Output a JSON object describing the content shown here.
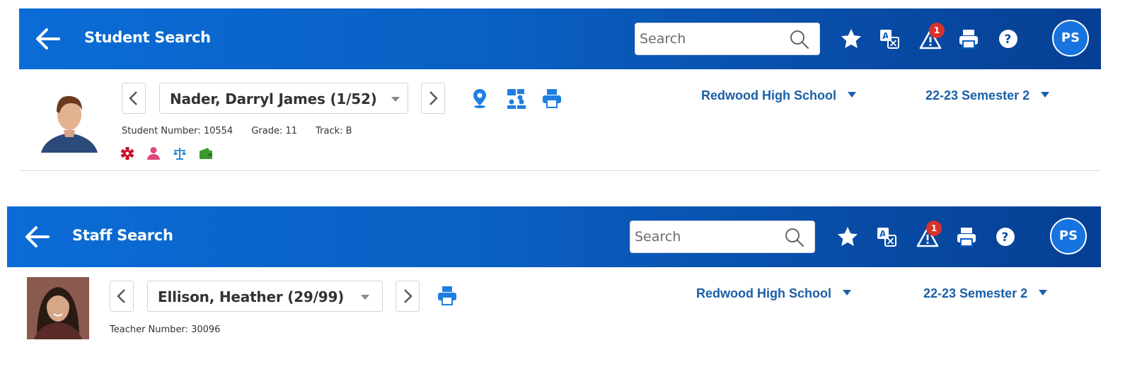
{
  "student_panel": {
    "header": {
      "title": "Student Search",
      "search_placeholder": "Search",
      "alert_count": "1",
      "user_initials": "PS"
    },
    "record": {
      "name_selector": "Nader, Darryl James  (1/52)",
      "details": [
        "Student Number: 10554",
        "Grade: 11",
        "Track: B"
      ],
      "indicator_icons": [
        "medical-alert-icon",
        "person-alert-icon",
        "legal-alert-icon",
        "fee-wallet-icon"
      ]
    },
    "school_selector": "Redwood High School",
    "term_selector": "22-23 Semester 2"
  },
  "staff_panel": {
    "header": {
      "title": "Staff Search",
      "search_placeholder": "Search",
      "alert_count": "1",
      "user_initials": "PS"
    },
    "record": {
      "name_selector": "Ellison, Heather  (29/99)",
      "details": [
        "Teacher Number: 30096"
      ]
    },
    "school_selector": "Redwood High School",
    "term_selector": "22-23 Semester 2"
  },
  "colors": {
    "header_blue_start": "#0b6cd6",
    "header_blue_end": "#063f93",
    "link_blue": "#1a5fa8",
    "alert_badge_red": "#d9322c",
    "medical_red": "#c8102e",
    "person_pink": "#e0457b",
    "legal_blue": "#2a8bd8",
    "wallet_green": "#3a9b2c"
  }
}
